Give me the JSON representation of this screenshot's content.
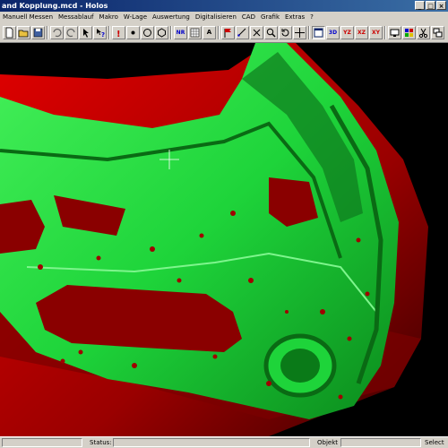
{
  "window": {
    "title": "and Kopplung.mcd - Holos",
    "buttons": {
      "minimize": "_",
      "maximize": "□",
      "close": "×"
    }
  },
  "menu": {
    "items": [
      "Manuell Messen",
      "Messablauf",
      "Makro",
      "W-Lage",
      "Auswertung",
      "Digitalisieren",
      "CAD",
      "Grafik",
      "Extras",
      "?"
    ]
  },
  "toolbar": {
    "nr_label": "NR",
    "a_label": "A",
    "view_3d": "3D",
    "view_yz": "YZ",
    "view_xz": "XZ",
    "view_xy": "XY",
    "accent_colors": {
      "red": "#cc0000",
      "blue": "#0000cc"
    }
  },
  "viewport": {
    "model": "car door inner panel",
    "colors": {
      "panel": "#1ed43a",
      "panel_shadow": "#0a6a14",
      "outer": "#c80000",
      "outer_dark": "#5a0000",
      "background": "#000000"
    }
  },
  "status": {
    "status_label": "Status:",
    "objekt_label": "Objekt",
    "select_label": "Select"
  }
}
